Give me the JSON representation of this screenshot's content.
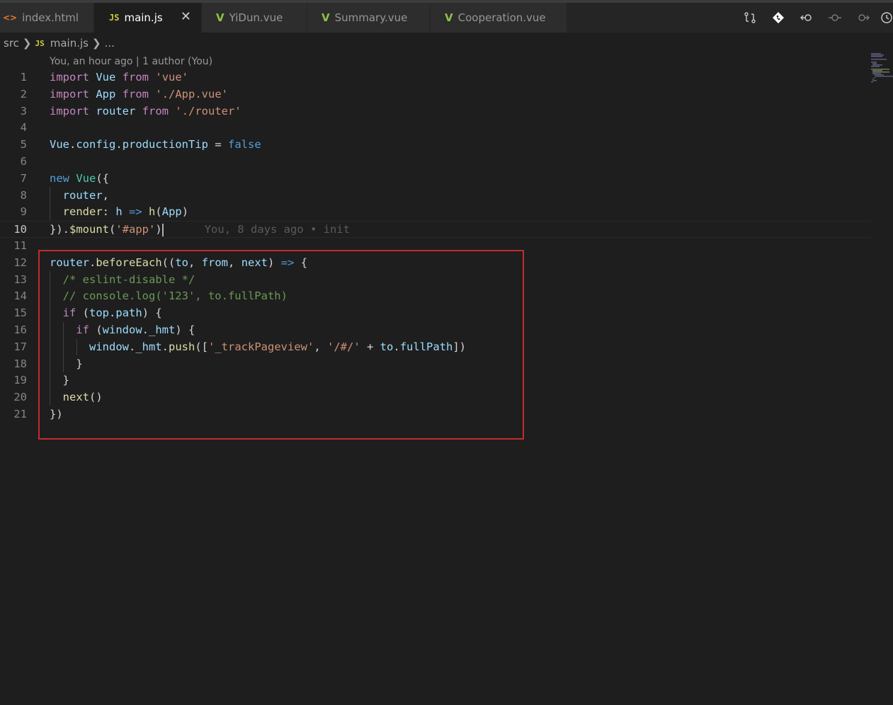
{
  "tabs": [
    {
      "icon": "<>",
      "label": "index.html",
      "active": false
    },
    {
      "icon": "JS",
      "label": "main.js",
      "active": true,
      "close": "✕"
    },
    {
      "icon": "V",
      "label": "YiDun.vue",
      "active": false
    },
    {
      "icon": "V",
      "label": "Summary.vue",
      "active": false
    },
    {
      "icon": "V",
      "label": "Cooperation.vue",
      "active": false
    }
  ],
  "breadcrumb": {
    "folder": "src",
    "file_icon": "JS",
    "file": "main.js",
    "rest": "..."
  },
  "codelens": "You, an hour ago | 1 author (You)",
  "blame": "You, 8 days ago • init",
  "colors": {
    "background": "#1e1e1e",
    "keyword": "#c586c0",
    "storage": "#569cd6",
    "variable": "#9cdcfe",
    "class": "#4ec9b0",
    "string": "#ce9178",
    "function": "#dcdcaa",
    "comment": "#6a9955",
    "highlight_border": "#c42b2b"
  },
  "line_numbers": [
    "1",
    "2",
    "3",
    "4",
    "5",
    "6",
    "7",
    "8",
    "9",
    "10",
    "11",
    "12",
    "13",
    "14",
    "15",
    "16",
    "17",
    "18",
    "19",
    "20",
    "21"
  ],
  "code": {
    "l1": [
      "import",
      " ",
      "Vue",
      " ",
      "from",
      " ",
      "'vue'"
    ],
    "l2": [
      "import",
      " ",
      "App",
      " ",
      "from",
      " ",
      "'./App.vue'"
    ],
    "l3": [
      "import",
      " ",
      "router",
      " ",
      "from",
      " ",
      "'./router'"
    ],
    "l5": [
      "Vue",
      ".",
      "config",
      ".",
      "productionTip",
      " = ",
      "false"
    ],
    "l7": [
      "new",
      " ",
      "Vue",
      "({"
    ],
    "l8": [
      "  ",
      "router",
      ","
    ],
    "l9": [
      "  ",
      "render",
      ": ",
      "h",
      " ",
      "=>",
      " ",
      "h",
      "(",
      "App",
      ")"
    ],
    "l10": [
      "})",
      ".",
      "$mount",
      "(",
      "'#app'",
      ")"
    ],
    "l12": [
      "router",
      ".",
      "beforeEach",
      "((",
      "to",
      ", ",
      "from",
      ", ",
      "next",
      ") ",
      "=>",
      " {"
    ],
    "l13": [
      "  ",
      "/* eslint-disable */"
    ],
    "l14": [
      "  ",
      "// console.log('123', to.fullPath)"
    ],
    "l15": [
      "  ",
      "if",
      " (",
      "top",
      ".",
      "path",
      ") {"
    ],
    "l16": [
      "    ",
      "if",
      " (",
      "window",
      ".",
      "_hmt",
      ") {"
    ],
    "l17": [
      "      ",
      "window",
      ".",
      "_hmt",
      ".",
      "push",
      "([",
      "'_trackPageview'",
      ", ",
      "'/#/'",
      " + ",
      "to",
      ".",
      "fullPath",
      "])"
    ],
    "l18": [
      "    ",
      "}"
    ],
    "l19": [
      "  ",
      "}"
    ],
    "l20": [
      "  ",
      "next",
      "()"
    ],
    "l21": [
      "})"
    ]
  }
}
